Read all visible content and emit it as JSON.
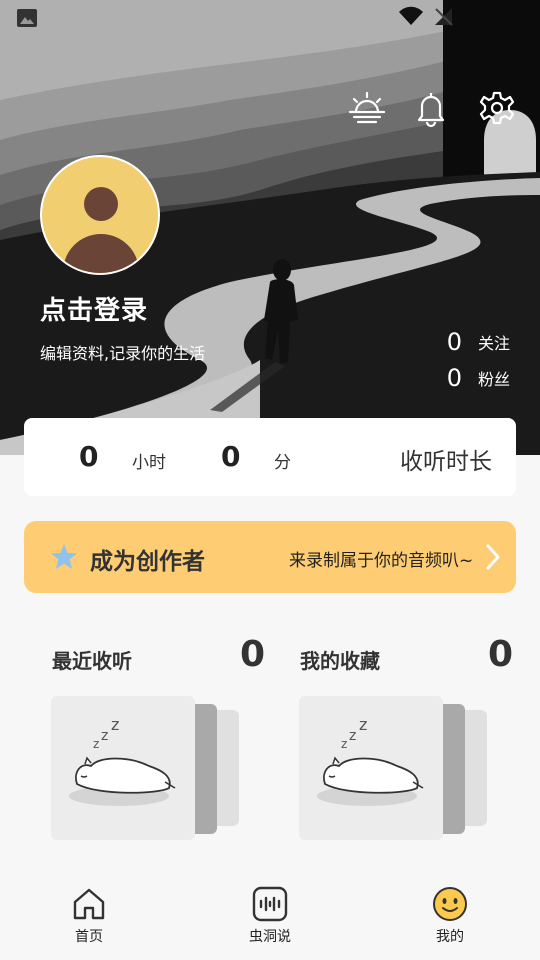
{
  "header": {
    "icons": [
      "sunrise-icon",
      "bell-icon",
      "gear-icon"
    ]
  },
  "profile": {
    "login_text": "点击登录",
    "subtitle": "编辑资料,记录你的生活",
    "following_count": "0",
    "following_label": "关注",
    "followers_count": "0",
    "followers_label": "粉丝",
    "avatar_colors": {
      "bg": "#f1cf71",
      "figure": "#6a4537"
    }
  },
  "listening_time": {
    "hours": "0",
    "hours_unit": "小时",
    "minutes": "0",
    "minutes_unit": "分",
    "title": "收听时长"
  },
  "creator_banner": {
    "title": "成为创作者",
    "subtitle": "来录制属于你的音频叭~",
    "color": "#fecd73",
    "star_color": "#8fc3ee"
  },
  "sections": {
    "recent": {
      "title": "最近收听",
      "count": "0"
    },
    "favorites": {
      "title": "我的收藏",
      "count": "0"
    }
  },
  "bottom_nav": {
    "items": [
      {
        "label": "首页",
        "icon": "home-icon"
      },
      {
        "label": "虫洞说",
        "icon": "audio-wave-icon"
      },
      {
        "label": "我的",
        "icon": "smiley-icon"
      }
    ]
  }
}
